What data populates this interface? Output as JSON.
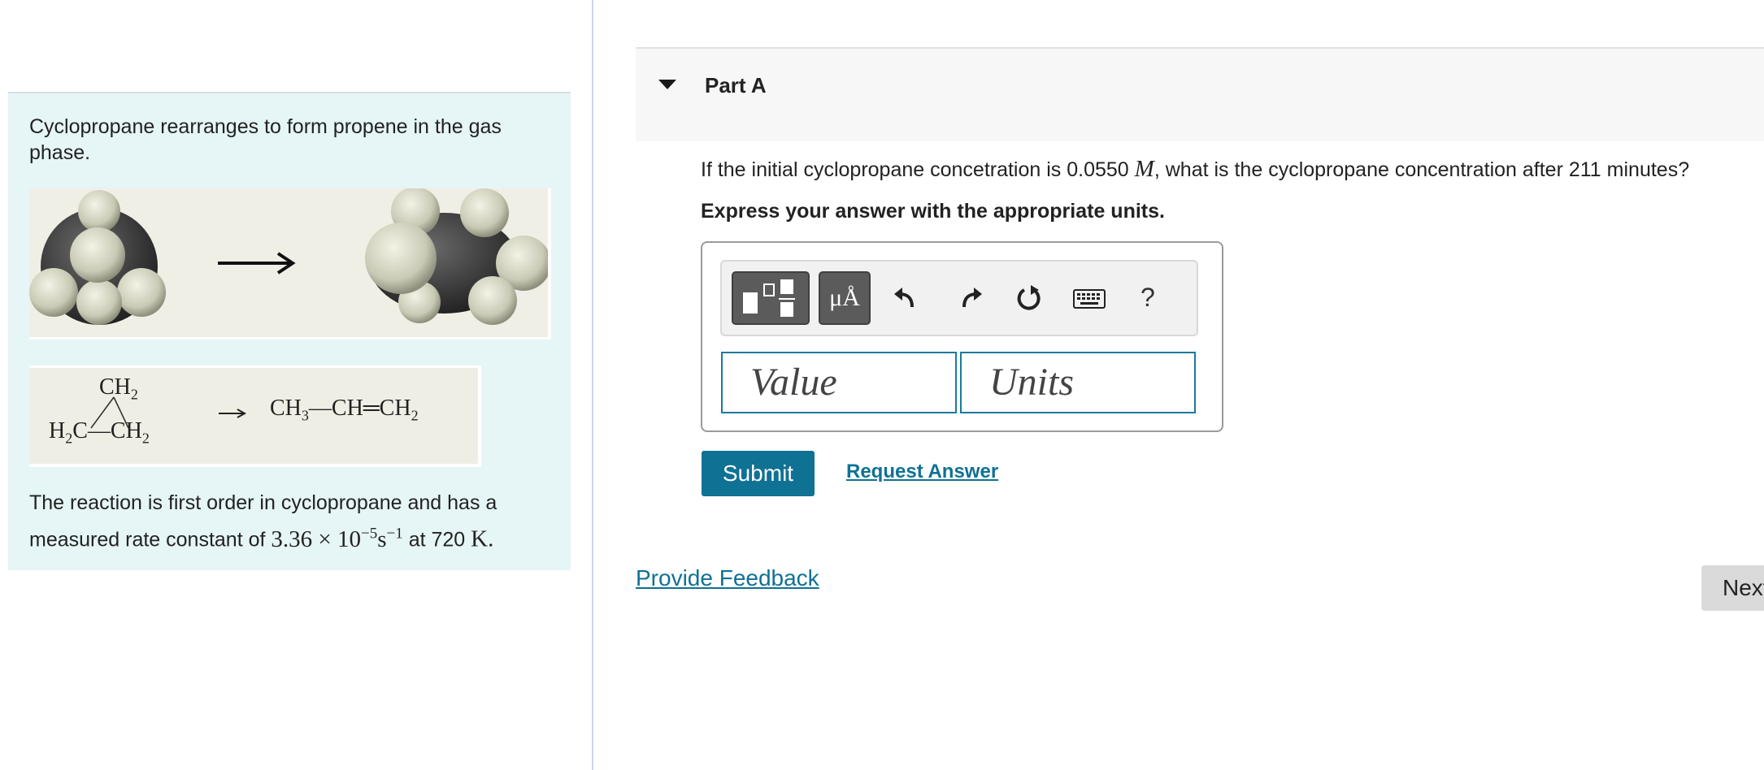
{
  "problem": {
    "intro": "Cyclopropane rearranges to form propene in the gas phase.",
    "structure": {
      "reactant_top": "CH",
      "reactant_top_sub": "2",
      "reactant_left": "H",
      "reactant_left_sub": "2",
      "reactant_left_c": "C",
      "reactant_right": "CH",
      "reactant_right_sub": "2",
      "product_1": "CH",
      "product_1_sub": "3",
      "product_2": "CH",
      "product_3": "CH",
      "product_3_sub": "2"
    },
    "reaction_text_1": "The reaction is first order in cyclopropane and has a measured rate constant of",
    "rate_mantissa": "3.36 × 10",
    "rate_exp": "−5",
    "rate_unit": "s",
    "rate_unit_exp": "−1",
    "reaction_text_at": "at 720",
    "temp_unit": "K",
    "reaction_text_end": "."
  },
  "part": {
    "title": "Part A",
    "question_pre": "If the initial cyclopropane concetration is 0.0550",
    "question_var": "M",
    "question_post": ", what is the cyclopropane concentration after 211 minutes?",
    "instruction": "Express your answer with the appropriate units."
  },
  "answer": {
    "value_placeholder": "Value",
    "units_placeholder": "Units",
    "units_button": "μÅ",
    "help": "?"
  },
  "actions": {
    "submit": "Submit",
    "request_answer": "Request Answer",
    "feedback": "Provide Feedback",
    "next": "Next"
  },
  "colors": {
    "accent": "#0f7194",
    "problem_bg": "#e6f5f6",
    "toolbar_button": "#5b5b5b"
  }
}
